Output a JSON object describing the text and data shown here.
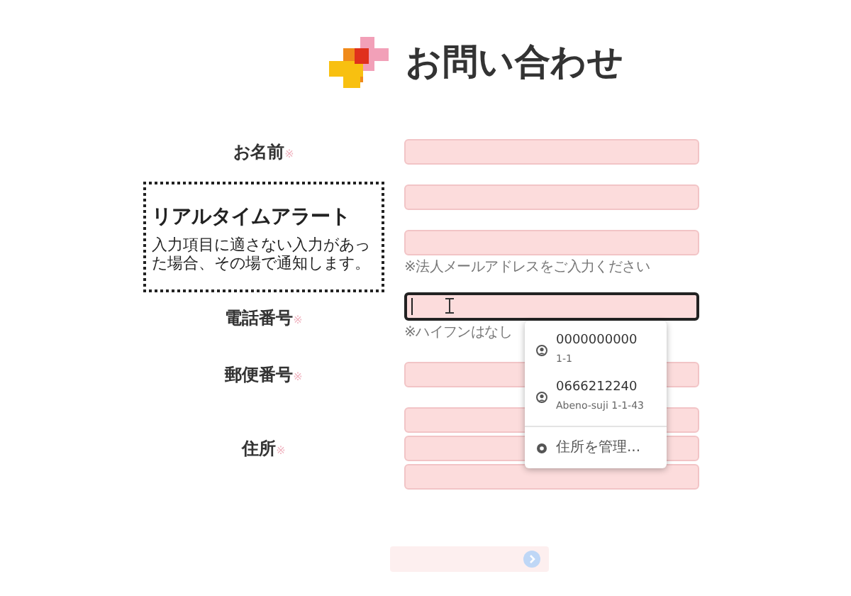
{
  "title": "お問い合わせ",
  "rows": [
    {
      "kind": "field",
      "label": "お名前",
      "required_mark": "※",
      "fields": [
        {
          "focused": false
        }
      ]
    },
    {
      "kind": "alert",
      "alert": {
        "title": "リアルタイムアラート",
        "body": "入力項目に適さない入力があった場合、その場で通知します。"
      },
      "fields": [
        {
          "focused": false
        },
        {
          "focused": false
        }
      ],
      "hint": "※法人メールアドレスをご入力ください"
    },
    {
      "kind": "field",
      "label": "電話番号",
      "required_mark": "※",
      "fields": [
        {
          "focused": true
        }
      ],
      "hint": "※ハイフンはなし"
    },
    {
      "kind": "field",
      "label": "郵便番号",
      "required_mark": "※",
      "fields": [
        {
          "focused": false
        }
      ]
    },
    {
      "kind": "field",
      "label": "住所",
      "required_mark": "※",
      "fields": [
        {
          "focused": false
        },
        {
          "focused": false
        },
        {
          "focused": false
        }
      ]
    }
  ],
  "autocomplete": {
    "items": [
      {
        "primary": "0000000000",
        "secondary": "1-1"
      },
      {
        "primary": "0666212240",
        "secondary": "Abeno-suji 1-1-43"
      }
    ],
    "manage": "住所を管理..."
  },
  "submit": {
    "disabled": true
  }
}
